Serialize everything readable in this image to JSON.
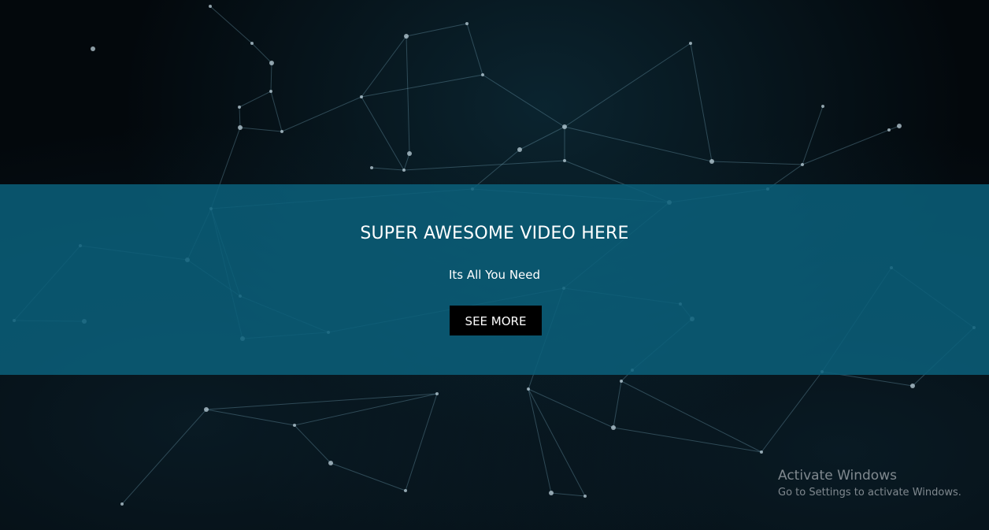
{
  "hero": {
    "title": "SUPER AWESOME VIDEO HERE",
    "subtitle": "Its All You Need",
    "button_label": "SEE MORE"
  },
  "watermark": {
    "title": "Activate Windows",
    "message": "Go to Settings to activate Windows."
  },
  "colors": {
    "background": "#03080c",
    "band": "#0b607a",
    "button": "#000000",
    "text": "#ffffff"
  }
}
